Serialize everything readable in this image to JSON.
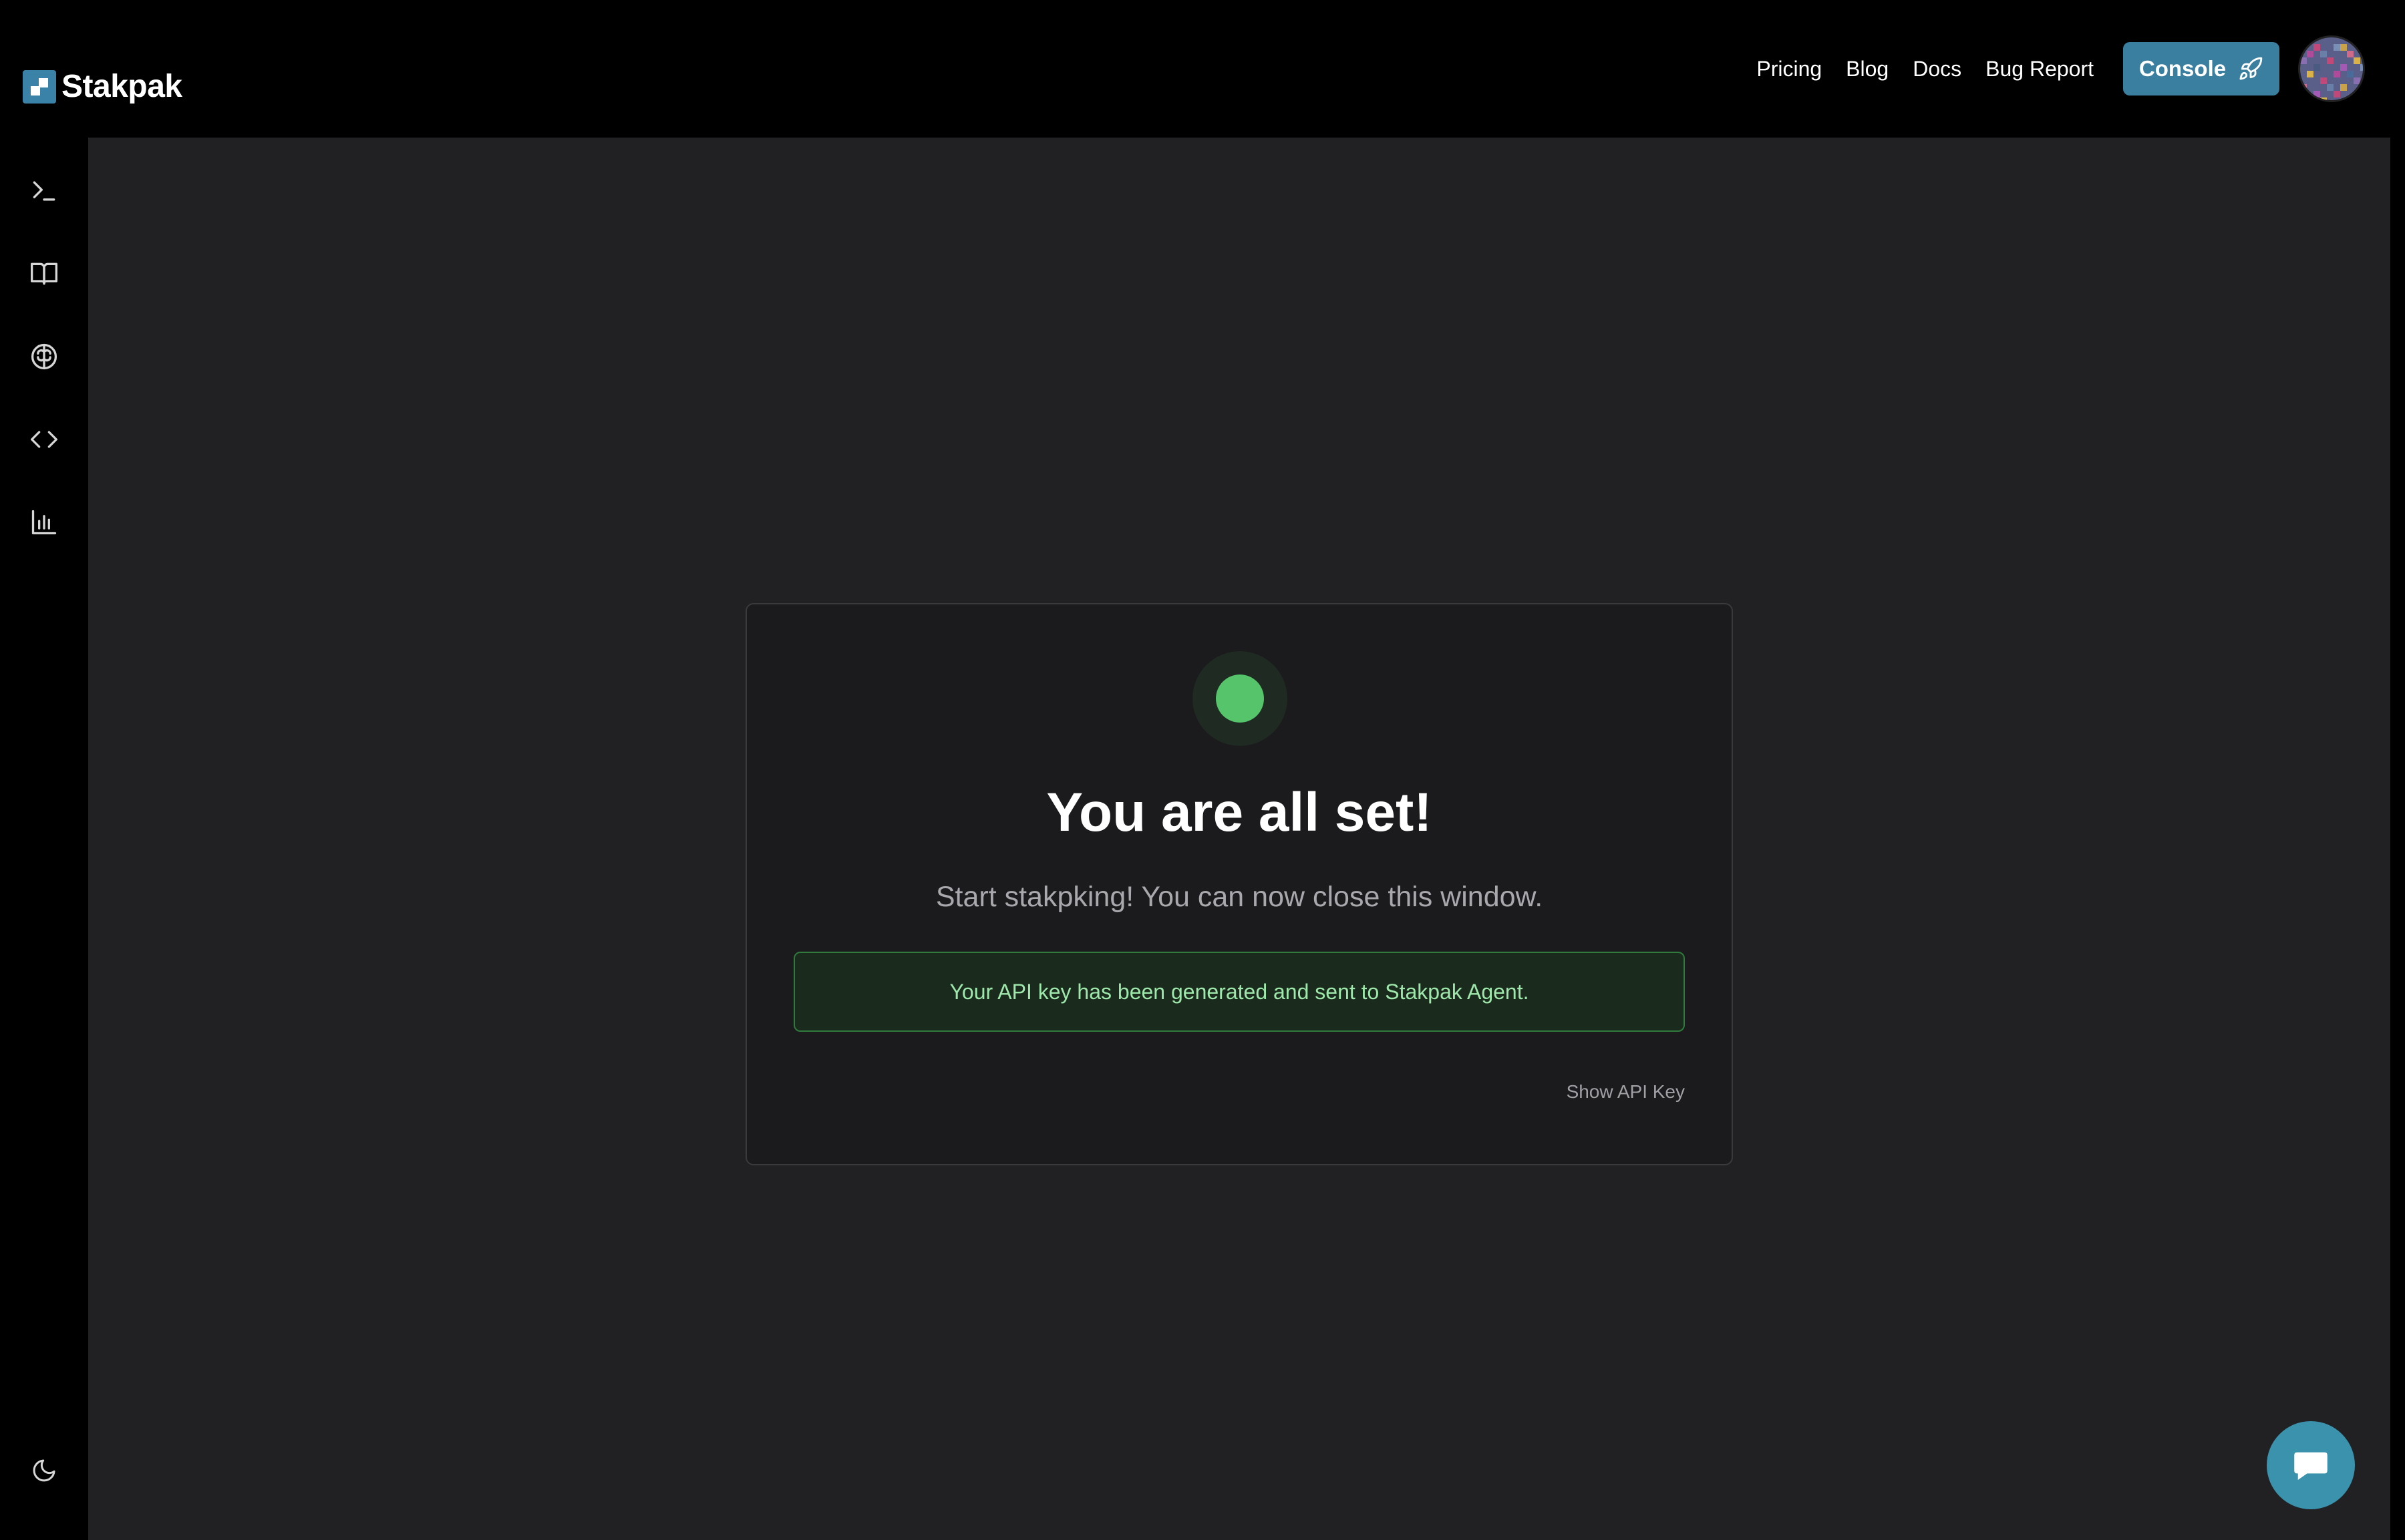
{
  "brand": {
    "name": "Stakpak",
    "accent": "#3b82a8"
  },
  "nav": {
    "links": [
      "Pricing",
      "Blog",
      "Docs",
      "Bug Report"
    ],
    "console_label": "Console"
  },
  "sidebar": {
    "items": [
      {
        "icon": "terminal-icon"
      },
      {
        "icon": "book-icon"
      },
      {
        "icon": "brain-icon"
      },
      {
        "icon": "code-icon"
      },
      {
        "icon": "bar-chart-icon"
      }
    ],
    "footer_icon": "moon-icon"
  },
  "card": {
    "title": "You are all set!",
    "subtitle": "Start stakpking! You can now close this window.",
    "notice": "Your API key has been generated and sent to Stakpak Agent.",
    "show_key_label": "Show API Key",
    "status_color": "#55c46a"
  },
  "chat": {
    "icon": "chat-icon",
    "color": "#3a92ad"
  }
}
